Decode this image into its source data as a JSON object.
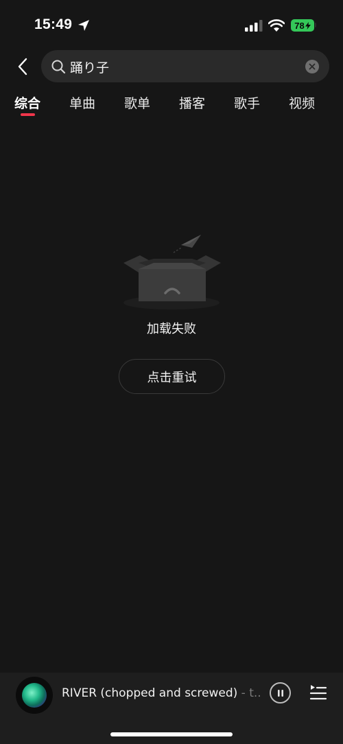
{
  "status_bar": {
    "time": "15:49",
    "battery": "78",
    "battery_color": "#34c759",
    "icons": [
      "location-arrow-icon",
      "cellular-signal-icon",
      "wifi-icon",
      "battery-icon"
    ]
  },
  "search": {
    "query": "踊り子",
    "icons": [
      "back-chevron-icon",
      "search-icon",
      "clear-icon"
    ]
  },
  "tabs": [
    {
      "label": "综合",
      "active": true
    },
    {
      "label": "单曲",
      "active": false
    },
    {
      "label": "歌单",
      "active": false
    },
    {
      "label": "播客",
      "active": false
    },
    {
      "label": "歌手",
      "active": false
    },
    {
      "label": "视频",
      "active": false
    }
  ],
  "tab_indicator_color": "#f0364b",
  "error_state": {
    "illustration": "empty-box-icon",
    "message": "加载失败",
    "retry_label": "点击重试"
  },
  "mini_player": {
    "title": "RIVER (chopped and screwed)",
    "artist_separator": " - t...",
    "state": "playing",
    "icons": [
      "album-art",
      "pause-icon",
      "playlist-icon"
    ]
  }
}
